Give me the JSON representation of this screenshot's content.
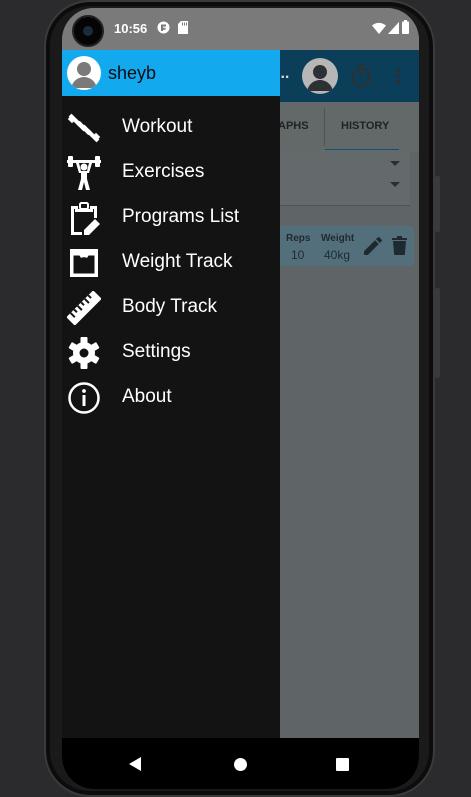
{
  "status_bar": {
    "time": "10:56"
  },
  "drawer": {
    "user_name": "sheyb",
    "items": [
      {
        "label": "Workout",
        "icon": "dumbbell-icon"
      },
      {
        "label": "Exercises",
        "icon": "weightlifter-icon"
      },
      {
        "label": "Programs List",
        "icon": "clipboard-edit-icon"
      },
      {
        "label": "Weight Track",
        "icon": "scale-icon"
      },
      {
        "label": "Body Track",
        "icon": "ruler-icon"
      },
      {
        "label": "Settings",
        "icon": "gear-icon"
      },
      {
        "label": "About",
        "icon": "info-icon"
      }
    ]
  },
  "background_app": {
    "title_fragment": "...",
    "tabs": [
      "APHS",
      "HISTORY"
    ],
    "history_card": {
      "reps_label": "Reps",
      "reps_value": "10",
      "weight_label": "Weight",
      "weight_value": "40kg"
    }
  },
  "colors": {
    "drawer_header": "#12a9ef",
    "drawer_bg": "#131313",
    "toolbar_dimmed": "#0b3e59"
  }
}
